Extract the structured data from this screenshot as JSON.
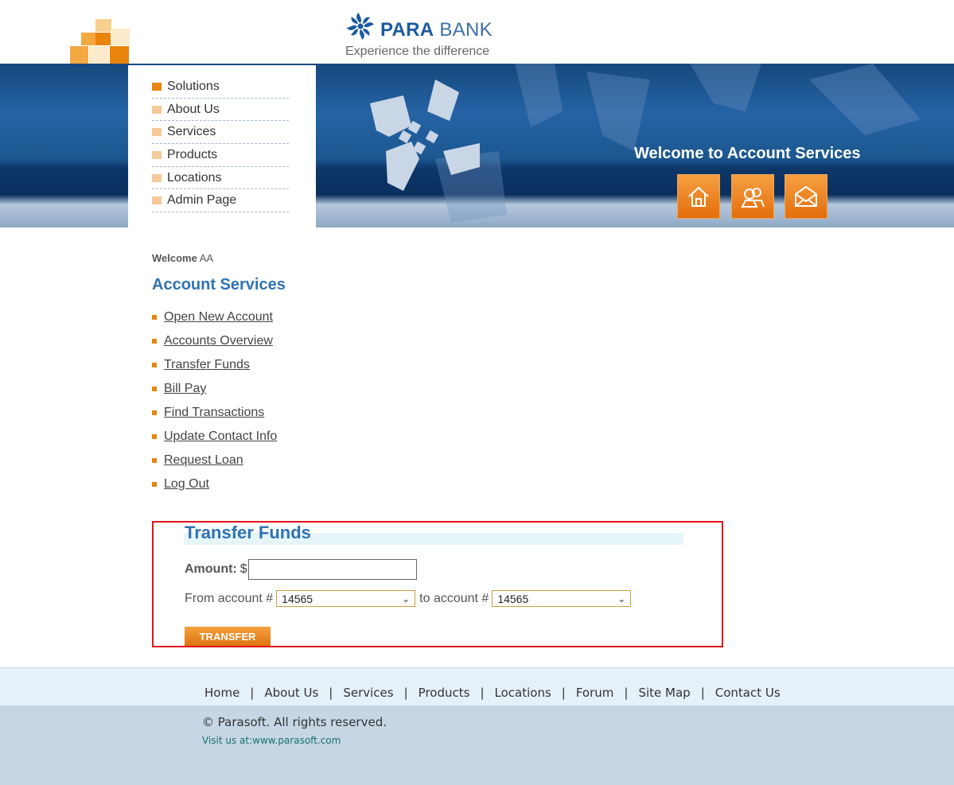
{
  "header": {
    "brand_bold": "PARA",
    "brand_rest": " BANK",
    "tagline": "Experience the difference"
  },
  "banner": {
    "welcome": "Welcome to Account Services",
    "buttons": [
      {
        "icon": "home-icon"
      },
      {
        "icon": "about-icon"
      },
      {
        "icon": "contact-mail-icon"
      }
    ]
  },
  "top_nav": {
    "items": [
      "Solutions",
      "About Us",
      "Services",
      "Products",
      "Locations",
      "Admin Page"
    ]
  },
  "user": {
    "welcome_label": "Welcome",
    "name": "AA"
  },
  "account_services": {
    "title": "Account Services",
    "links": [
      "Open New Account",
      "Accounts Overview",
      "Transfer Funds",
      "Bill Pay",
      "Find Transactions",
      "Update Contact Info",
      "Request Loan",
      "Log Out"
    ]
  },
  "transfer": {
    "title": "Transfer Funds",
    "amount_label": "Amount:",
    "currency": "$",
    "amount_value": "",
    "from_label": "From account #",
    "from_value": "14565",
    "to_label": "to account #",
    "to_value": "14565",
    "button": "TRANSFER"
  },
  "footer": {
    "links": [
      "Home",
      "About Us",
      "Services",
      "Products",
      "Locations",
      "Forum",
      "Site Map",
      "Contact Us"
    ],
    "separator": "|",
    "copyright": "© Parasoft. All rights reserved.",
    "visit": "Visit us at:www.parasoft.com"
  },
  "colors": {
    "accent_orange": "#e8850c",
    "link_blue": "#2f72b4",
    "highlight_border": "#e1141b",
    "banner_blue": "#1c578f"
  }
}
